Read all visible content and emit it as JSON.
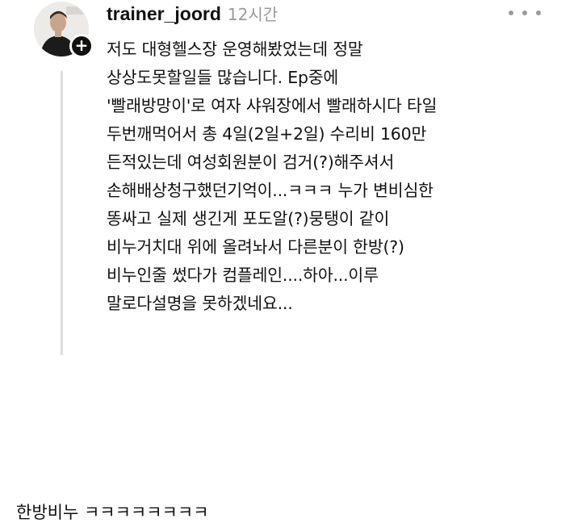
{
  "post": {
    "username": "trainer_joord",
    "time": "12시간",
    "body_lines": [
      "저도 대형헬스장 운영해봤었는데 정말",
      "상상도못할일들 많습니다. Ep중에",
      "'빨래방망이'로 여자 샤워장에서 빨래하시다 타일",
      "두번깨먹어서 총 4일(2일+2일) 수리비 160만",
      "든적있는데 여성회원분이 검거(?)해주셔서",
      "손해배상청구했던기억이...ㅋㅋㅋ 누가 변비심한",
      "똥싸고 실제 생긴게 포도알(?)뭉탱이 같이",
      "비누거치대 위에 올려놔서 다른분이 한방(?)",
      "비누인줄 썼다가 컴플레인....하아...이루",
      "말로다설명을 못하겠네요..."
    ],
    "icons": {
      "avatar": "profile-photo",
      "add": "plus-icon",
      "more": "more-dots-icon"
    }
  },
  "caption": "한방비누 ㅋㅋㅋㅋㅋㅋㅋㅋ"
}
